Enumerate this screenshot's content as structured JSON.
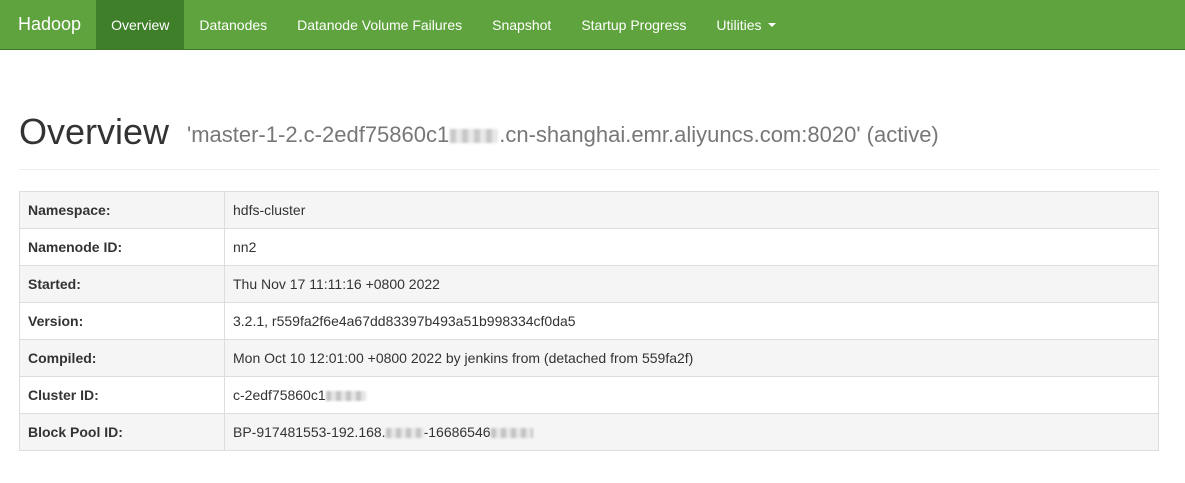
{
  "navbar": {
    "brand": "Hadoop",
    "items": [
      {
        "label": "Overview",
        "active": true
      },
      {
        "label": "Datanodes",
        "active": false
      },
      {
        "label": "Datanode Volume Failures",
        "active": false
      },
      {
        "label": "Snapshot",
        "active": false
      },
      {
        "label": "Startup Progress",
        "active": false
      },
      {
        "label": "Utilities",
        "active": false,
        "dropdown": true
      }
    ],
    "bg_color": "#5fa33e",
    "active_color": "#3f7f2a"
  },
  "header": {
    "title": "Overview",
    "subtitle_prefix": "'master-1-2.c-2edf75860c1",
    "subtitle_suffix": ".cn-shanghai.emr.aliyuncs.com:8020' (active)"
  },
  "info_table": {
    "rows": [
      {
        "key": "Namespace:",
        "value": "hdfs-cluster"
      },
      {
        "key": "Namenode ID:",
        "value": "nn2"
      },
      {
        "key": "Started:",
        "value": "Thu Nov 17 11:11:16 +0800 2022"
      },
      {
        "key": "Version:",
        "value": "3.2.1, r559fa2f6e4a67dd83397b493a51b998334cf0da5"
      },
      {
        "key": "Compiled:",
        "value": "Mon Oct 10 12:01:00 +0800 2022 by jenkins from (detached from 559fa2f)"
      },
      {
        "key": "Cluster ID:",
        "value": "c-2edf75860c1"
      },
      {
        "key": "Block Pool ID:",
        "value_part1": "BP-917481553-192.168.",
        "value_part2": "-16686546"
      }
    ]
  }
}
